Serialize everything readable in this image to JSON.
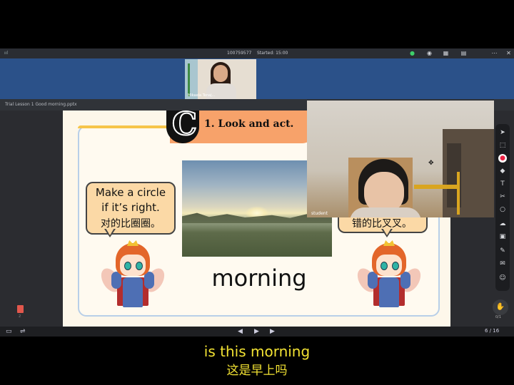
{
  "topbar": {
    "meeting_id": "100759577",
    "started": "Started: 15:00",
    "icons": [
      "signal-icon",
      "mic-icon",
      "camera-icon",
      "grid-icon",
      "more-icon",
      "close-icon"
    ]
  },
  "teacher_video": {
    "label": "Mikaela Tenaj..."
  },
  "file": {
    "name": "Trial Lesson 1 Good morning.pptx"
  },
  "slide": {
    "section_letter": "C",
    "title": "1. Look and act.",
    "bubble_left": [
      "Make a circle",
      "if it’s right.",
      "对的比圈圈。"
    ],
    "bubble_right": "错的比叉叉。",
    "word": "morning"
  },
  "student_video": {
    "label": "student"
  },
  "toolbar_right": {
    "icons": [
      "cursor-icon",
      "select-icon",
      "eraser-icon",
      "pen-icon",
      "text-icon",
      "scissors-icon",
      "shape-icon",
      "cloud-icon",
      "box-icon",
      "edit-icon",
      "chat-icon",
      "users-icon"
    ],
    "raise_hand_count": "0/1"
  },
  "bottom": {
    "prev": "◀",
    "play": "▶",
    "next": "▶",
    "page": "6 / 16",
    "thumb_page": "2"
  },
  "subtitles": {
    "en": "is this morning",
    "cn": "这是早上吗"
  }
}
